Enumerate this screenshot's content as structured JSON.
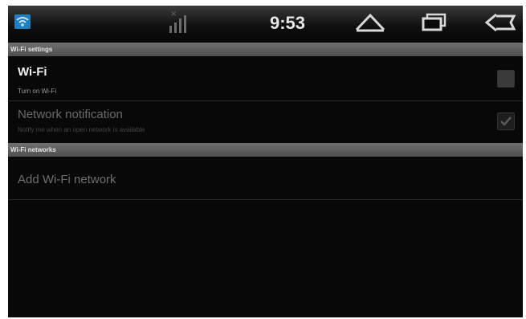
{
  "status_bar": {
    "time": "9:53",
    "icons": [
      "wifi-icon",
      "signal-icon",
      "home-icon",
      "recent-apps-icon",
      "back-icon"
    ]
  },
  "sections": {
    "wifi_settings_header": "Wi-Fi settings",
    "wifi_networks_header": "Wi-Fi networks"
  },
  "wifi": {
    "title": "Wi-Fi",
    "summary": "Turn on Wi-Fi",
    "checked": false
  },
  "network_notification": {
    "title": "Network notification",
    "summary": "Notify me when an open network is available",
    "checked": true,
    "enabled": false
  },
  "add_network": {
    "label": "Add Wi-Fi network"
  },
  "colors": {
    "wifi_icon_blue": "#1e7fc2",
    "background": "#080808",
    "header_gray": "#5e5e5e"
  }
}
